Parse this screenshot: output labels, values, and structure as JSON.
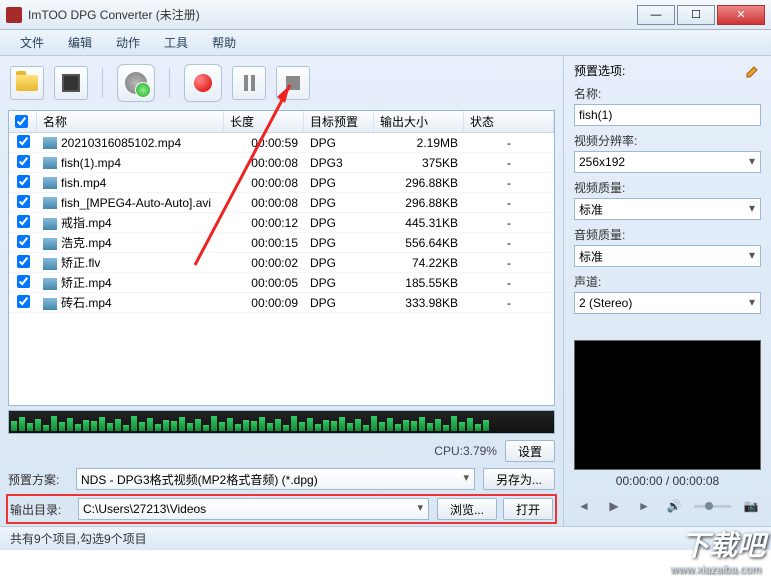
{
  "window": {
    "title": "ImTOO DPG Converter (未注册)"
  },
  "menu": {
    "file": "文件",
    "edit": "编辑",
    "action": "动作",
    "tool": "工具",
    "help": "帮助"
  },
  "table": {
    "headers": {
      "name": "名称",
      "duration": "长度",
      "preset": "目标预置",
      "size": "输出大小",
      "status": "状态"
    },
    "rows": [
      {
        "name": "20210316085102.mp4",
        "dur": "00:00:59",
        "preset": "DPG",
        "size": "2.19MB",
        "status": "-"
      },
      {
        "name": "fish(1).mp4",
        "dur": "00:00:08",
        "preset": "DPG3",
        "size": "375KB",
        "status": "-"
      },
      {
        "name": "fish.mp4",
        "dur": "00:00:08",
        "preset": "DPG",
        "size": "296.88KB",
        "status": "-"
      },
      {
        "name": "fish_[MPEG4-Auto-Auto].avi",
        "dur": "00:00:08",
        "preset": "DPG",
        "size": "296.88KB",
        "status": "-"
      },
      {
        "name": "戒指.mp4",
        "dur": "00:00:12",
        "preset": "DPG",
        "size": "445.31KB",
        "status": "-"
      },
      {
        "name": "浩克.mp4",
        "dur": "00:00:15",
        "preset": "DPG",
        "size": "556.64KB",
        "status": "-"
      },
      {
        "name": "矫正.flv",
        "dur": "00:00:02",
        "preset": "DPG",
        "size": "74.22KB",
        "status": "-"
      },
      {
        "name": "矫正.mp4",
        "dur": "00:00:05",
        "preset": "DPG",
        "size": "185.55KB",
        "status": "-"
      },
      {
        "name": "砖石.mp4",
        "dur": "00:00:09",
        "preset": "DPG",
        "size": "333.98KB",
        "status": "-"
      }
    ]
  },
  "cpu": {
    "label": "CPU:3.79%",
    "settings": "设置"
  },
  "preset_row": {
    "label": "预置方案:",
    "value": "NDS - DPG3格式视频(MP2格式音频) (*.dpg)",
    "saveas": "另存为..."
  },
  "output_row": {
    "label": "输出目录:",
    "value": "C:\\Users\\27213\\Videos",
    "browse": "浏览...",
    "open": "打开"
  },
  "status": {
    "text": "共有9个项目,勾选9个项目"
  },
  "panel": {
    "title": "预置选项:",
    "name_lbl": "名称:",
    "name_val": "fish(1)",
    "res_lbl": "视频分辨率:",
    "res_val": "256x192",
    "vq_lbl": "视频质量:",
    "vq_val": "标准",
    "aq_lbl": "音频质量:",
    "aq_val": "标准",
    "ch_lbl": "声道:",
    "ch_val": "2 (Stereo)"
  },
  "preview": {
    "time": "00:00:00 / 00:00:08"
  },
  "watermark": {
    "text": "下载吧",
    "url": "www.xiazaiba.com"
  }
}
